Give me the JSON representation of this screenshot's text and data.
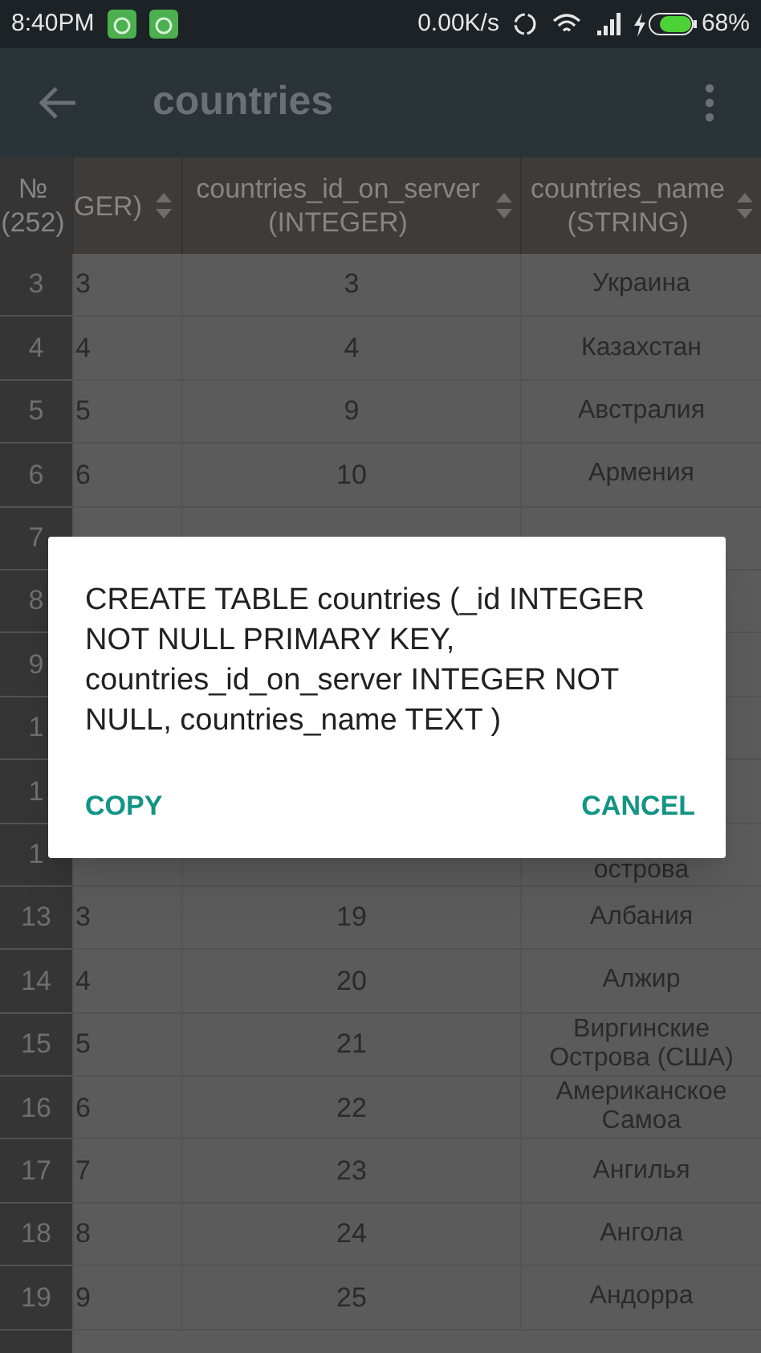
{
  "status_bar": {
    "time": "8:40PM",
    "network_speed": "0.00K/s",
    "battery": "68%"
  },
  "toolbar": {
    "title": "countries"
  },
  "table": {
    "columns": [
      {
        "lines": [
          "№",
          "(252)"
        ],
        "kind": "row_number"
      },
      {
        "lines": [
          "GER)"
        ],
        "kind": "field"
      },
      {
        "lines": [
          "countries_id_on_server",
          "(INTEGER)"
        ],
        "kind": "field"
      },
      {
        "lines": [
          "countries_name",
          "(STRING)"
        ],
        "kind": "field"
      }
    ],
    "rows": [
      {
        "cells": [
          "3",
          "3",
          "3",
          "Украина"
        ]
      },
      {
        "cells": [
          "4",
          "4",
          "4",
          "Казахстан"
        ]
      },
      {
        "cells": [
          "5",
          "5",
          "9",
          "Австралия"
        ]
      },
      {
        "cells": [
          "6",
          "6",
          "10",
          "Армения"
        ]
      },
      {
        "cells": [
          "7"
        ]
      },
      {
        "cells": [
          "8"
        ]
      },
      {
        "cells": [
          "9"
        ]
      },
      {
        "cells": [
          "1"
        ]
      },
      {
        "cells": [
          "1"
        ]
      },
      {
        "cells": [
          "1",
          "",
          "",
          "острова"
        ]
      },
      {
        "cells": [
          "13",
          "3",
          "19",
          "Албания"
        ]
      },
      {
        "cells": [
          "14",
          "4",
          "20",
          "Алжир"
        ]
      },
      {
        "cells": [
          "15",
          "5",
          "21",
          "Виргинские Острова (США)"
        ]
      },
      {
        "cells": [
          "16",
          "6",
          "22",
          "Американское Самоа"
        ]
      },
      {
        "cells": [
          "17",
          "7",
          "23",
          "Ангилья"
        ]
      },
      {
        "cells": [
          "18",
          "8",
          "24",
          "Ангола"
        ]
      },
      {
        "cells": [
          "19",
          "9",
          "25",
          "Андорра"
        ]
      }
    ]
  },
  "dialog": {
    "message": "CREATE TABLE countries (_id INTEGER NOT NULL PRIMARY KEY, countries_id_on_server INTEGER NOT NULL, countries_name TEXT )",
    "buttons": [
      "COPY",
      "CANCEL"
    ]
  }
}
